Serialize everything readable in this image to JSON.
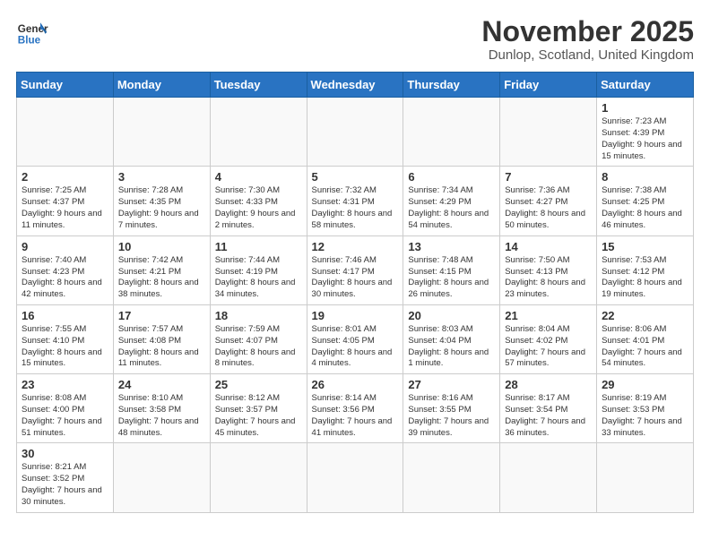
{
  "logo": {
    "line1": "General",
    "line2": "Blue"
  },
  "title": "November 2025",
  "location": "Dunlop, Scotland, United Kingdom",
  "weekdays": [
    "Sunday",
    "Monday",
    "Tuesday",
    "Wednesday",
    "Thursday",
    "Friday",
    "Saturday"
  ],
  "weeks": [
    [
      {
        "day": "",
        "info": ""
      },
      {
        "day": "",
        "info": ""
      },
      {
        "day": "",
        "info": ""
      },
      {
        "day": "",
        "info": ""
      },
      {
        "day": "",
        "info": ""
      },
      {
        "day": "",
        "info": ""
      },
      {
        "day": "1",
        "info": "Sunrise: 7:23 AM\nSunset: 4:39 PM\nDaylight: 9 hours\nand 15 minutes."
      }
    ],
    [
      {
        "day": "2",
        "info": "Sunrise: 7:25 AM\nSunset: 4:37 PM\nDaylight: 9 hours\nand 11 minutes."
      },
      {
        "day": "3",
        "info": "Sunrise: 7:28 AM\nSunset: 4:35 PM\nDaylight: 9 hours\nand 7 minutes."
      },
      {
        "day": "4",
        "info": "Sunrise: 7:30 AM\nSunset: 4:33 PM\nDaylight: 9 hours\nand 2 minutes."
      },
      {
        "day": "5",
        "info": "Sunrise: 7:32 AM\nSunset: 4:31 PM\nDaylight: 8 hours\nand 58 minutes."
      },
      {
        "day": "6",
        "info": "Sunrise: 7:34 AM\nSunset: 4:29 PM\nDaylight: 8 hours\nand 54 minutes."
      },
      {
        "day": "7",
        "info": "Sunrise: 7:36 AM\nSunset: 4:27 PM\nDaylight: 8 hours\nand 50 minutes."
      },
      {
        "day": "8",
        "info": "Sunrise: 7:38 AM\nSunset: 4:25 PM\nDaylight: 8 hours\nand 46 minutes."
      }
    ],
    [
      {
        "day": "9",
        "info": "Sunrise: 7:40 AM\nSunset: 4:23 PM\nDaylight: 8 hours\nand 42 minutes."
      },
      {
        "day": "10",
        "info": "Sunrise: 7:42 AM\nSunset: 4:21 PM\nDaylight: 8 hours\nand 38 minutes."
      },
      {
        "day": "11",
        "info": "Sunrise: 7:44 AM\nSunset: 4:19 PM\nDaylight: 8 hours\nand 34 minutes."
      },
      {
        "day": "12",
        "info": "Sunrise: 7:46 AM\nSunset: 4:17 PM\nDaylight: 8 hours\nand 30 minutes."
      },
      {
        "day": "13",
        "info": "Sunrise: 7:48 AM\nSunset: 4:15 PM\nDaylight: 8 hours\nand 26 minutes."
      },
      {
        "day": "14",
        "info": "Sunrise: 7:50 AM\nSunset: 4:13 PM\nDaylight: 8 hours\nand 23 minutes."
      },
      {
        "day": "15",
        "info": "Sunrise: 7:53 AM\nSunset: 4:12 PM\nDaylight: 8 hours\nand 19 minutes."
      }
    ],
    [
      {
        "day": "16",
        "info": "Sunrise: 7:55 AM\nSunset: 4:10 PM\nDaylight: 8 hours\nand 15 minutes."
      },
      {
        "day": "17",
        "info": "Sunrise: 7:57 AM\nSunset: 4:08 PM\nDaylight: 8 hours\nand 11 minutes."
      },
      {
        "day": "18",
        "info": "Sunrise: 7:59 AM\nSunset: 4:07 PM\nDaylight: 8 hours\nand 8 minutes."
      },
      {
        "day": "19",
        "info": "Sunrise: 8:01 AM\nSunset: 4:05 PM\nDaylight: 8 hours\nand 4 minutes."
      },
      {
        "day": "20",
        "info": "Sunrise: 8:03 AM\nSunset: 4:04 PM\nDaylight: 8 hours\nand 1 minute."
      },
      {
        "day": "21",
        "info": "Sunrise: 8:04 AM\nSunset: 4:02 PM\nDaylight: 7 hours\nand 57 minutes."
      },
      {
        "day": "22",
        "info": "Sunrise: 8:06 AM\nSunset: 4:01 PM\nDaylight: 7 hours\nand 54 minutes."
      }
    ],
    [
      {
        "day": "23",
        "info": "Sunrise: 8:08 AM\nSunset: 4:00 PM\nDaylight: 7 hours\nand 51 minutes."
      },
      {
        "day": "24",
        "info": "Sunrise: 8:10 AM\nSunset: 3:58 PM\nDaylight: 7 hours\nand 48 minutes."
      },
      {
        "day": "25",
        "info": "Sunrise: 8:12 AM\nSunset: 3:57 PM\nDaylight: 7 hours\nand 45 minutes."
      },
      {
        "day": "26",
        "info": "Sunrise: 8:14 AM\nSunset: 3:56 PM\nDaylight: 7 hours\nand 41 minutes."
      },
      {
        "day": "27",
        "info": "Sunrise: 8:16 AM\nSunset: 3:55 PM\nDaylight: 7 hours\nand 39 minutes."
      },
      {
        "day": "28",
        "info": "Sunrise: 8:17 AM\nSunset: 3:54 PM\nDaylight: 7 hours\nand 36 minutes."
      },
      {
        "day": "29",
        "info": "Sunrise: 8:19 AM\nSunset: 3:53 PM\nDaylight: 7 hours\nand 33 minutes."
      }
    ],
    [
      {
        "day": "30",
        "info": "Sunrise: 8:21 AM\nSunset: 3:52 PM\nDaylight: 7 hours\nand 30 minutes."
      },
      {
        "day": "",
        "info": ""
      },
      {
        "day": "",
        "info": ""
      },
      {
        "day": "",
        "info": ""
      },
      {
        "day": "",
        "info": ""
      },
      {
        "day": "",
        "info": ""
      },
      {
        "day": "",
        "info": ""
      }
    ]
  ]
}
